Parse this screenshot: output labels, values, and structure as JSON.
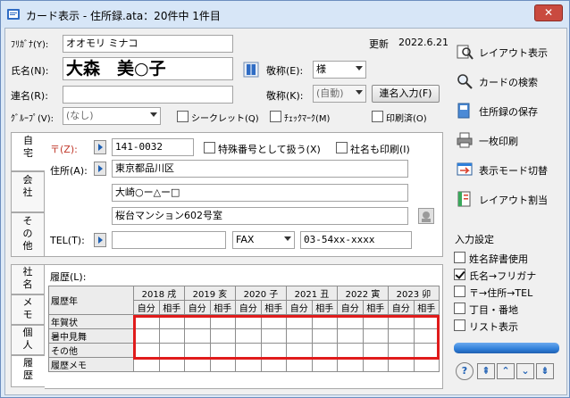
{
  "window": {
    "title": "カード表示 - 住所録.ata：20件中 1件目",
    "close": "✕"
  },
  "form": {
    "furigana_label": "ﾌﾘｶﾞﾅ(Y):",
    "furigana_value": "オオモリ ミナコ",
    "updated_label": "更新",
    "updated_value": "2022.6.21",
    "name_label": "氏名(N):",
    "name_value": "大森　美○子",
    "honorific_label": "敬称(E):",
    "honorific_value": "様",
    "joint_label": "連名(R):",
    "joint_value": "",
    "honorific2_label": "敬称(K):",
    "honorific2_value": "(自動)",
    "joint_input_button": "連名入力(F)",
    "group_label": "ｸﾞﾙｰﾌﾟ(V):",
    "group_value": "(なし)",
    "secret_label": "シークレット(Q)",
    "checkmark_label": "ﾁｪｯｸﾏｰｸ(M)",
    "printed_label": "印刷済(O)"
  },
  "tabs_top": [
    "自宅",
    "会社",
    "その他"
  ],
  "address": {
    "zip_label": "〒(Z):",
    "zip_value": "141-0032",
    "special_label": "特殊番号として扱う(X)",
    "company_print_label": "社名も印刷(I)",
    "addr_label": "住所(A):",
    "addr1": "東京都品川区",
    "addr2": "大崎○ー△ー□",
    "addr3": "桜台マンション602号室",
    "tel_label": "TEL(T):",
    "tel_value": "",
    "fax_type": "FAX",
    "fax_value": "03-54xx-xxxx"
  },
  "tabs_bottom": [
    "社名",
    "メモ",
    "個人",
    "履歴"
  ],
  "history": {
    "label": "履歴(L):",
    "corner": "履歴年",
    "years": [
      "2018 戌",
      "2019 亥",
      "2020 子",
      "2021 丑",
      "2022 寅",
      "2023 卯"
    ],
    "sub_self": "自分",
    "sub_other": "相手",
    "rows": [
      "年賀状",
      "暑中見舞",
      "その他",
      "履歴メモ"
    ]
  },
  "sidebar": {
    "buttons": [
      "レイアウト表示",
      "カードの検索",
      "住所録の保存",
      "一枚印刷",
      "表示モード切替",
      "レイアウト割当"
    ],
    "settings_label": "入力設定",
    "options": [
      {
        "label": "姓名辞書使用",
        "checked": false
      },
      {
        "label": "氏名→フリガナ",
        "checked": true
      },
      {
        "label": "〒→住所→TEL",
        "checked": false
      },
      {
        "label": "丁目・番地",
        "checked": false
      },
      {
        "label": "リスト表示",
        "checked": false
      }
    ],
    "nav": [
      "?",
      "⇞",
      "⌃",
      "⌄",
      "⇟"
    ]
  },
  "colors": {
    "highlight_border": "#e01b1b",
    "progress_bar": "#2f7fd9",
    "accent_blue": "#1d5fb3"
  }
}
